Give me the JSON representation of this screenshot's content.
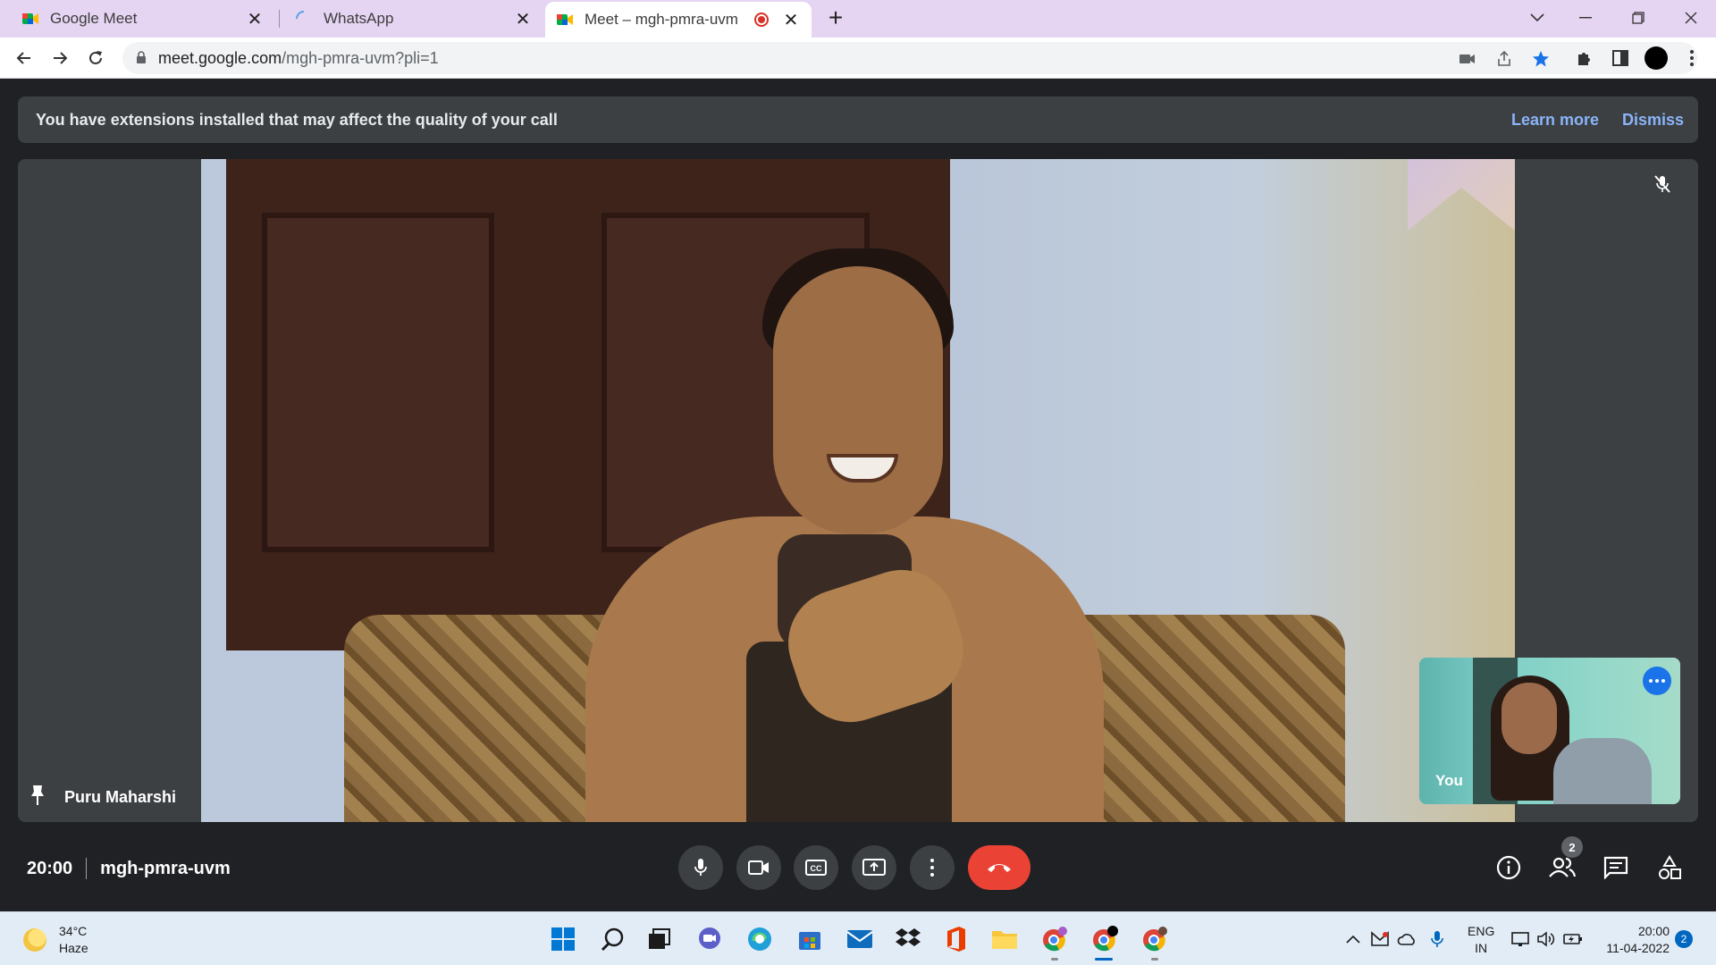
{
  "browser": {
    "tabs": [
      {
        "title": "Google Meet",
        "icon": "google-meet-icon"
      },
      {
        "title": "WhatsApp",
        "icon": "loading-spinner-icon"
      },
      {
        "title": "Meet – mgh-pmra-uvm",
        "icon": "google-meet-icon",
        "active": true,
        "recording": true
      }
    ],
    "url_host": "meet.google.com",
    "url_path": "/mgh-pmra-uvm?pli=1"
  },
  "meet": {
    "banner": {
      "message": "You have extensions installed that may affect the quality of your call",
      "learn_more": "Learn more",
      "dismiss": "Dismiss"
    },
    "main_participant": "Puru Maharshi",
    "self_label": "You",
    "time": "20:00",
    "meeting_code": "mgh-pmra-uvm",
    "participant_count": "2",
    "colors": {
      "end_call": "#ea4335",
      "link": "#8ab4f8",
      "self_more": "#1a73e8"
    }
  },
  "taskbar": {
    "weather_temp": "34°C",
    "weather_desc": "Haze",
    "lang_primary": "ENG",
    "lang_region": "IN",
    "clock_time": "20:00",
    "clock_date": "11-04-2022",
    "notifications": "2"
  }
}
